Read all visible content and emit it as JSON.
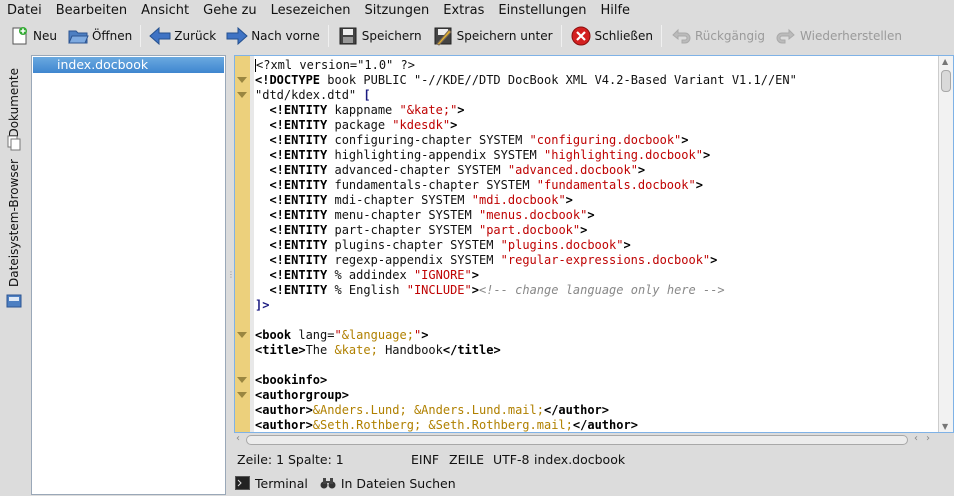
{
  "menubar": {
    "items": [
      "Datei",
      "Bearbeiten",
      "Ansicht",
      "Gehe zu",
      "Lesezeichen",
      "Sitzungen",
      "Extras",
      "Einstellungen",
      "Hilfe"
    ]
  },
  "toolbar": {
    "new_label": "Neu",
    "open_label": "Öffnen",
    "back_label": "Zurück",
    "forward_label": "Nach vorne",
    "save_label": "Speichern",
    "save_as_label": "Speichern unter",
    "close_label": "Schließen",
    "undo_label": "Rückgängig",
    "redo_label": "Wiederherstellen"
  },
  "sidebar": {
    "tab_documents": "Dokumente",
    "tab_filesystem": "Dateisystem-Browser",
    "files": [
      "index.docbook"
    ]
  },
  "editor": {
    "lines": [
      [
        {
          "c": "",
          "t": "<?xml version=\"1.0\" ?>"
        }
      ],
      [
        {
          "c": "t-tag",
          "t": "<!DOCTYPE"
        },
        {
          "c": "",
          "t": " book PUBLIC \"-//KDE//DTD DocBook XML V4.2-Based Variant V1.1//EN\""
        }
      ],
      [
        {
          "c": "",
          "t": "\"dtd/kdex.dtd\" "
        },
        {
          "c": "t-kw",
          "t": "["
        }
      ],
      [
        {
          "c": "t-tag",
          "t": "  <!ENTITY"
        },
        {
          "c": "",
          "t": " kappname "
        },
        {
          "c": "t-str",
          "t": "\"&kate;\""
        },
        {
          "c": "t-tag",
          "t": ">"
        }
      ],
      [
        {
          "c": "t-tag",
          "t": "  <!ENTITY"
        },
        {
          "c": "",
          "t": " package "
        },
        {
          "c": "t-str",
          "t": "\"kdesdk\""
        },
        {
          "c": "t-tag",
          "t": ">"
        }
      ],
      [
        {
          "c": "t-tag",
          "t": "  <!ENTITY"
        },
        {
          "c": "",
          "t": " configuring-chapter SYSTEM "
        },
        {
          "c": "t-str",
          "t": "\"configuring.docbook\""
        },
        {
          "c": "t-tag",
          "t": ">"
        }
      ],
      [
        {
          "c": "t-tag",
          "t": "  <!ENTITY"
        },
        {
          "c": "",
          "t": " highlighting-appendix SYSTEM "
        },
        {
          "c": "t-str",
          "t": "\"highlighting.docbook\""
        },
        {
          "c": "t-tag",
          "t": ">"
        }
      ],
      [
        {
          "c": "t-tag",
          "t": "  <!ENTITY"
        },
        {
          "c": "",
          "t": " advanced-chapter SYSTEM "
        },
        {
          "c": "t-str",
          "t": "\"advanced.docbook\""
        },
        {
          "c": "t-tag",
          "t": ">"
        }
      ],
      [
        {
          "c": "t-tag",
          "t": "  <!ENTITY"
        },
        {
          "c": "",
          "t": " fundamentals-chapter SYSTEM "
        },
        {
          "c": "t-str",
          "t": "\"fundamentals.docbook\""
        },
        {
          "c": "t-tag",
          "t": ">"
        }
      ],
      [
        {
          "c": "t-tag",
          "t": "  <!ENTITY"
        },
        {
          "c": "",
          "t": " mdi-chapter SYSTEM "
        },
        {
          "c": "t-str",
          "t": "\"mdi.docbook\""
        },
        {
          "c": "t-tag",
          "t": ">"
        }
      ],
      [
        {
          "c": "t-tag",
          "t": "  <!ENTITY"
        },
        {
          "c": "",
          "t": " menu-chapter SYSTEM "
        },
        {
          "c": "t-str",
          "t": "\"menus.docbook\""
        },
        {
          "c": "t-tag",
          "t": ">"
        }
      ],
      [
        {
          "c": "t-tag",
          "t": "  <!ENTITY"
        },
        {
          "c": "",
          "t": " part-chapter SYSTEM "
        },
        {
          "c": "t-str",
          "t": "\"part.docbook\""
        },
        {
          "c": "t-tag",
          "t": ">"
        }
      ],
      [
        {
          "c": "t-tag",
          "t": "  <!ENTITY"
        },
        {
          "c": "",
          "t": " plugins-chapter SYSTEM "
        },
        {
          "c": "t-str",
          "t": "\"plugins.docbook\""
        },
        {
          "c": "t-tag",
          "t": ">"
        }
      ],
      [
        {
          "c": "t-tag",
          "t": "  <!ENTITY"
        },
        {
          "c": "",
          "t": " regexp-appendix SYSTEM "
        },
        {
          "c": "t-str",
          "t": "\"regular-expressions.docbook\""
        },
        {
          "c": "t-tag",
          "t": ">"
        }
      ],
      [
        {
          "c": "t-tag",
          "t": "  <!ENTITY"
        },
        {
          "c": "",
          "t": " % addindex "
        },
        {
          "c": "t-str",
          "t": "\"IGNORE\""
        },
        {
          "c": "t-tag",
          "t": ">"
        }
      ],
      [
        {
          "c": "t-tag",
          "t": "  <!ENTITY"
        },
        {
          "c": "",
          "t": " % English "
        },
        {
          "c": "t-str",
          "t": "\"INCLUDE\""
        },
        {
          "c": "t-tag",
          "t": ">"
        },
        {
          "c": "t-cmt",
          "t": "<!-- change language only here -->"
        }
      ],
      [
        {
          "c": "t-kw",
          "t": "]>"
        }
      ],
      [
        {
          "c": "",
          "t": ""
        }
      ],
      [
        {
          "c": "t-tag",
          "t": "<book"
        },
        {
          "c": "",
          "t": " lang="
        },
        {
          "c": "t-str",
          "t": "\""
        },
        {
          "c": "t-ent",
          "t": "&language;"
        },
        {
          "c": "t-str",
          "t": "\""
        },
        {
          "c": "t-tag",
          "t": ">"
        }
      ],
      [
        {
          "c": "t-tag",
          "t": "<title>"
        },
        {
          "c": "",
          "t": "The "
        },
        {
          "c": "t-ent",
          "t": "&kate;"
        },
        {
          "c": "",
          "t": " Handbook"
        },
        {
          "c": "t-tag",
          "t": "</title>"
        }
      ],
      [
        {
          "c": "",
          "t": ""
        }
      ],
      [
        {
          "c": "t-tag",
          "t": "<bookinfo>"
        }
      ],
      [
        {
          "c": "t-tag",
          "t": "<authorgroup>"
        }
      ],
      [
        {
          "c": "t-tag",
          "t": "<author>"
        },
        {
          "c": "t-ent",
          "t": "&Anders.Lund; &Anders.Lund.mail;"
        },
        {
          "c": "t-tag",
          "t": "</author>"
        }
      ],
      [
        {
          "c": "t-tag",
          "t": "<author>"
        },
        {
          "c": "t-ent",
          "t": "&Seth.Rothberg; &Seth.Rothberg.mail;"
        },
        {
          "c": "t-tag",
          "t": "</author>"
        }
      ]
    ]
  },
  "status": {
    "position": "Zeile: 1 Spalte: 1",
    "mode": "EINF",
    "selection": "ZEILE",
    "encoding": "UTF-8",
    "filename": "index.docbook"
  },
  "bottom": {
    "terminal_label": "Terminal",
    "search_label": "In Dateien Suchen"
  },
  "colors": {
    "selection": "#3f86cf",
    "fold_bar": "#ecd07c",
    "string": "#bf0303",
    "entity": "#b08000",
    "comment": "#888888"
  }
}
